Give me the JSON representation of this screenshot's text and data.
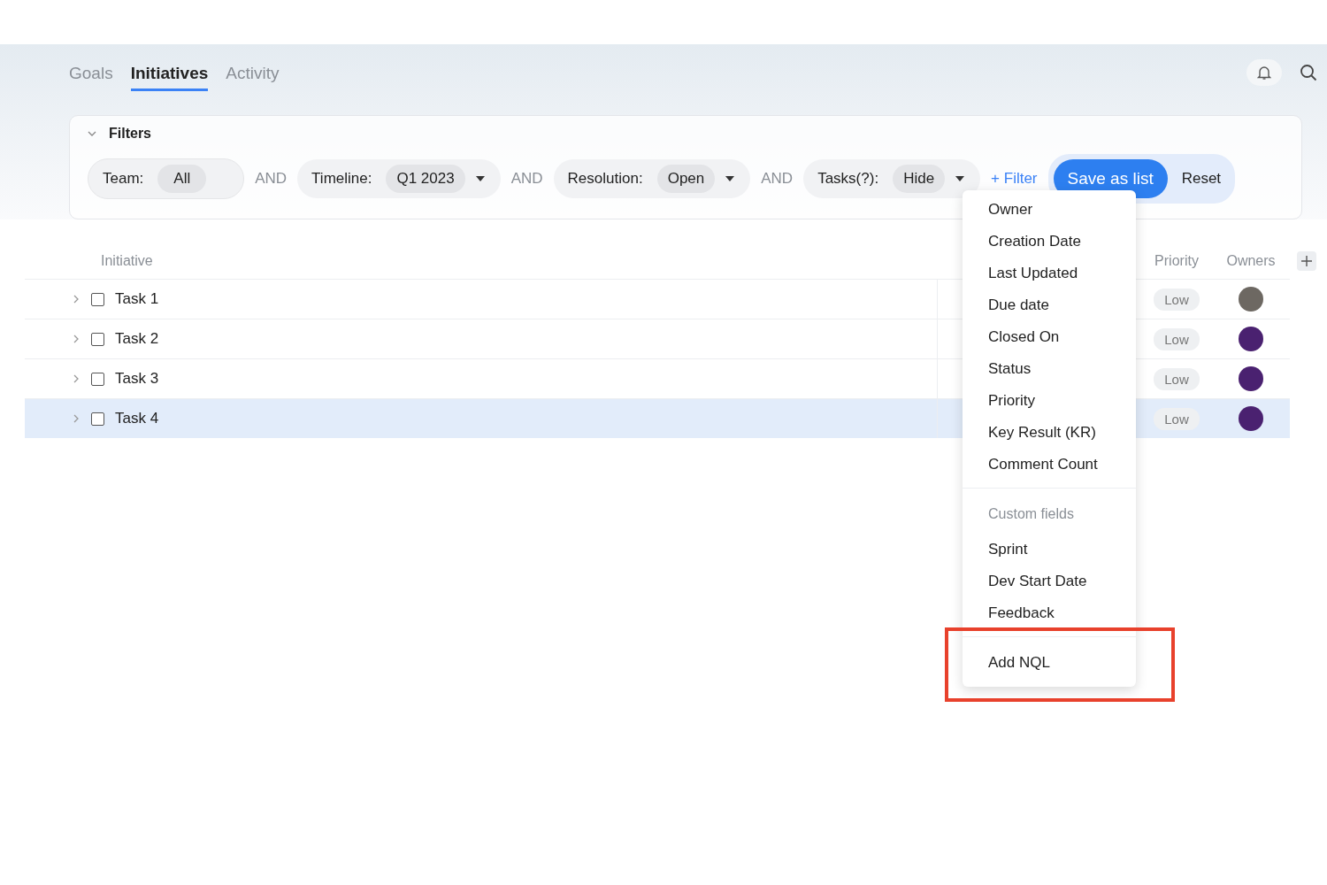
{
  "tabs": [
    {
      "label": "Goals",
      "selected": false
    },
    {
      "label": "Initiatives",
      "selected": true
    },
    {
      "label": "Activity",
      "selected": false
    }
  ],
  "filters": {
    "title": "Filters",
    "expanded": true,
    "chips": [
      {
        "label": "Team:",
        "value": "All",
        "has_dropdown": false
      },
      {
        "connector": "AND",
        "label": "Timeline:",
        "value": "Q1 2023",
        "has_dropdown": true
      },
      {
        "connector": "AND",
        "label": "Resolution:",
        "value": "Open",
        "has_dropdown": true
      },
      {
        "connector": "AND",
        "label": "Tasks(?):",
        "value": "Hide",
        "has_dropdown": true
      }
    ],
    "add_filter": "+ Filter",
    "save_button": "Save as list",
    "reset_button": "Reset"
  },
  "table": {
    "columns": {
      "initiative": "Initiative",
      "priority": "Priority",
      "owners": "Owners"
    },
    "rows": [
      {
        "name": "Task 1",
        "expanded": false,
        "checked": false,
        "selected": false,
        "priority": "Low",
        "owner": {
          "color": "#6d6862"
        }
      },
      {
        "name": "Task 2",
        "expanded": false,
        "checked": false,
        "selected": false,
        "priority": "Low",
        "owner": {
          "color": "#4a2170"
        }
      },
      {
        "name": "Task 3",
        "expanded": false,
        "checked": false,
        "selected": false,
        "priority": "Low",
        "owner": {
          "color": "#4a2170"
        }
      },
      {
        "name": "Task 4",
        "expanded": false,
        "checked": false,
        "selected": true,
        "priority": "Low",
        "owner": {
          "color": "#4a2170"
        }
      }
    ]
  },
  "filter_menu": {
    "items": [
      {
        "kind": "item",
        "label": "Owner"
      },
      {
        "kind": "item",
        "label": "Creation Date"
      },
      {
        "kind": "item",
        "label": "Last Updated"
      },
      {
        "kind": "item",
        "label": "Due date"
      },
      {
        "kind": "item",
        "label": "Closed On"
      },
      {
        "kind": "item",
        "label": "Status"
      },
      {
        "kind": "item",
        "label": "Priority"
      },
      {
        "kind": "item",
        "label": "Key Result (KR)"
      },
      {
        "kind": "item",
        "label": "Comment Count"
      },
      {
        "kind": "divider"
      },
      {
        "kind": "header",
        "label": "Custom fields"
      },
      {
        "kind": "item",
        "label": "Sprint"
      },
      {
        "kind": "item",
        "label": "Dev Start Date"
      },
      {
        "kind": "item",
        "label": "Feedback"
      },
      {
        "kind": "divider"
      },
      {
        "kind": "item",
        "label": "Add NQL",
        "highlighted": true
      }
    ]
  }
}
